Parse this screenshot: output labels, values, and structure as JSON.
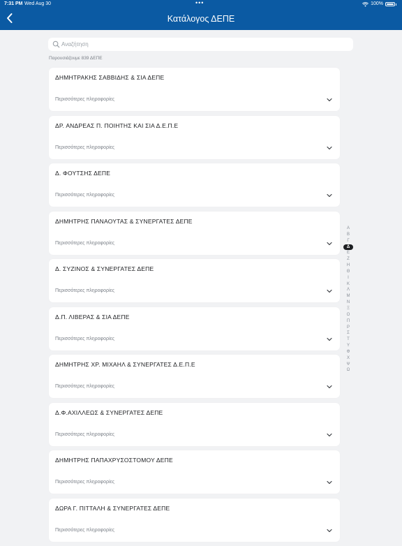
{
  "status_bar": {
    "time": "7:31 PM",
    "date": "Wed Aug 30",
    "dots": "•••",
    "battery": "100%"
  },
  "nav": {
    "title": "Κατάλογος ΔΕΠΕ",
    "back_icon": "chevron-left-icon"
  },
  "search": {
    "placeholder": "Αναζήτηση",
    "value": "",
    "icon": "search-icon"
  },
  "count_text": "Παρουσιάζουμε 839 ΔΕΠΕ",
  "more_label": "Περισσότερες πληροφορίες",
  "items": [
    {
      "name": "ΔΗΜΗΤΡΑΚΗΣ ΣΑΒΒΙΔΗΣ & ΣΙΑ ΔΕΠΕ"
    },
    {
      "name": "ΔΡ. ΑΝΔΡΕΑΣ Π. ΠΟΙΗΤΗΣ ΚΑΙ ΣΙΑ Δ.Ε.Π.Ε"
    },
    {
      "name": "Δ. ΦΟΥΤΣΗΣ ΔΕΠΕ"
    },
    {
      "name": "ΔΗΜΗΤΡΗΣ ΠΑΝΑΟΥΤΑΣ & ΣΥΝΕΡΓΑΤΕΣ ΔΕΠΕ"
    },
    {
      "name": "Δ. ΣΥΖΙΝΟΣ & ΣΥΝΕΡΓΑΤΕΣ ΔΕΠΕ"
    },
    {
      "name": "Δ.Π. ΛΙΒΕΡΑΣ & ΣΙΑ ΔΕΠΕ"
    },
    {
      "name": "ΔΗΜΗΤΡΗΣ ΧΡ. ΜΙΧΑΗΛ & ΣΥΝΕΡΓΑΤΕΣ Δ.Ε.Π.Ε"
    },
    {
      "name": "Δ.Φ.ΑΧΙΛΛΕΩΣ & ΣΥΝΕΡΓΑΤΕΣ ΔΕΠΕ"
    },
    {
      "name": "ΔΗΜΗΤΡΗΣ ΠΑΠΑΧΡΥΣΟΣΤΟΜΟΥ ΔΕΠΕ"
    },
    {
      "name": "ΔΩΡΑ Γ. ΠΙΤΤΑΛΗ & ΣΥΝΕΡΓΑΤΕΣ ΔΕΠΕ"
    }
  ],
  "alphabet": [
    "Α",
    "Β",
    "Γ",
    "Δ",
    "Ε",
    "Ζ",
    "Η",
    "Θ",
    "Ι",
    "Κ",
    "Λ",
    "Μ",
    "Ν",
    "Ξ",
    "Ο",
    "Π",
    "Ρ",
    "Σ",
    "Τ",
    "Υ",
    "Φ",
    "Χ",
    "Ψ",
    "Ω"
  ],
  "active_letter": "Δ",
  "colors": {
    "header": "#0b5aa3",
    "background": "#f1f2f4",
    "card": "#ffffff",
    "active_letter_bg": "#1d1f22"
  }
}
